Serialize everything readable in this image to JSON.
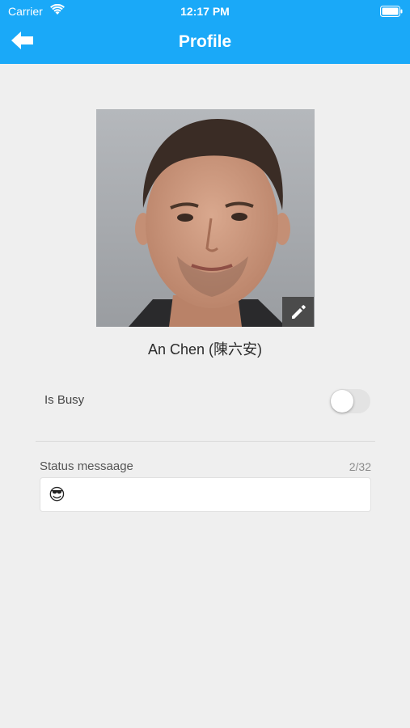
{
  "status_bar": {
    "carrier": "Carrier",
    "time": "12:17 PM"
  },
  "header": {
    "title": "Profile",
    "color": "#1aa9f8"
  },
  "icons": {
    "back": "arrow-left-icon",
    "edit": "pencil-icon",
    "wifi": "wifi-icon",
    "battery": "battery-icon"
  },
  "profile": {
    "name": "An Chen (陳六安)"
  },
  "busy": {
    "label": "Is Busy",
    "enabled": false
  },
  "status_message": {
    "label": "Status messaage",
    "counter": "2/32",
    "value": "😎"
  }
}
